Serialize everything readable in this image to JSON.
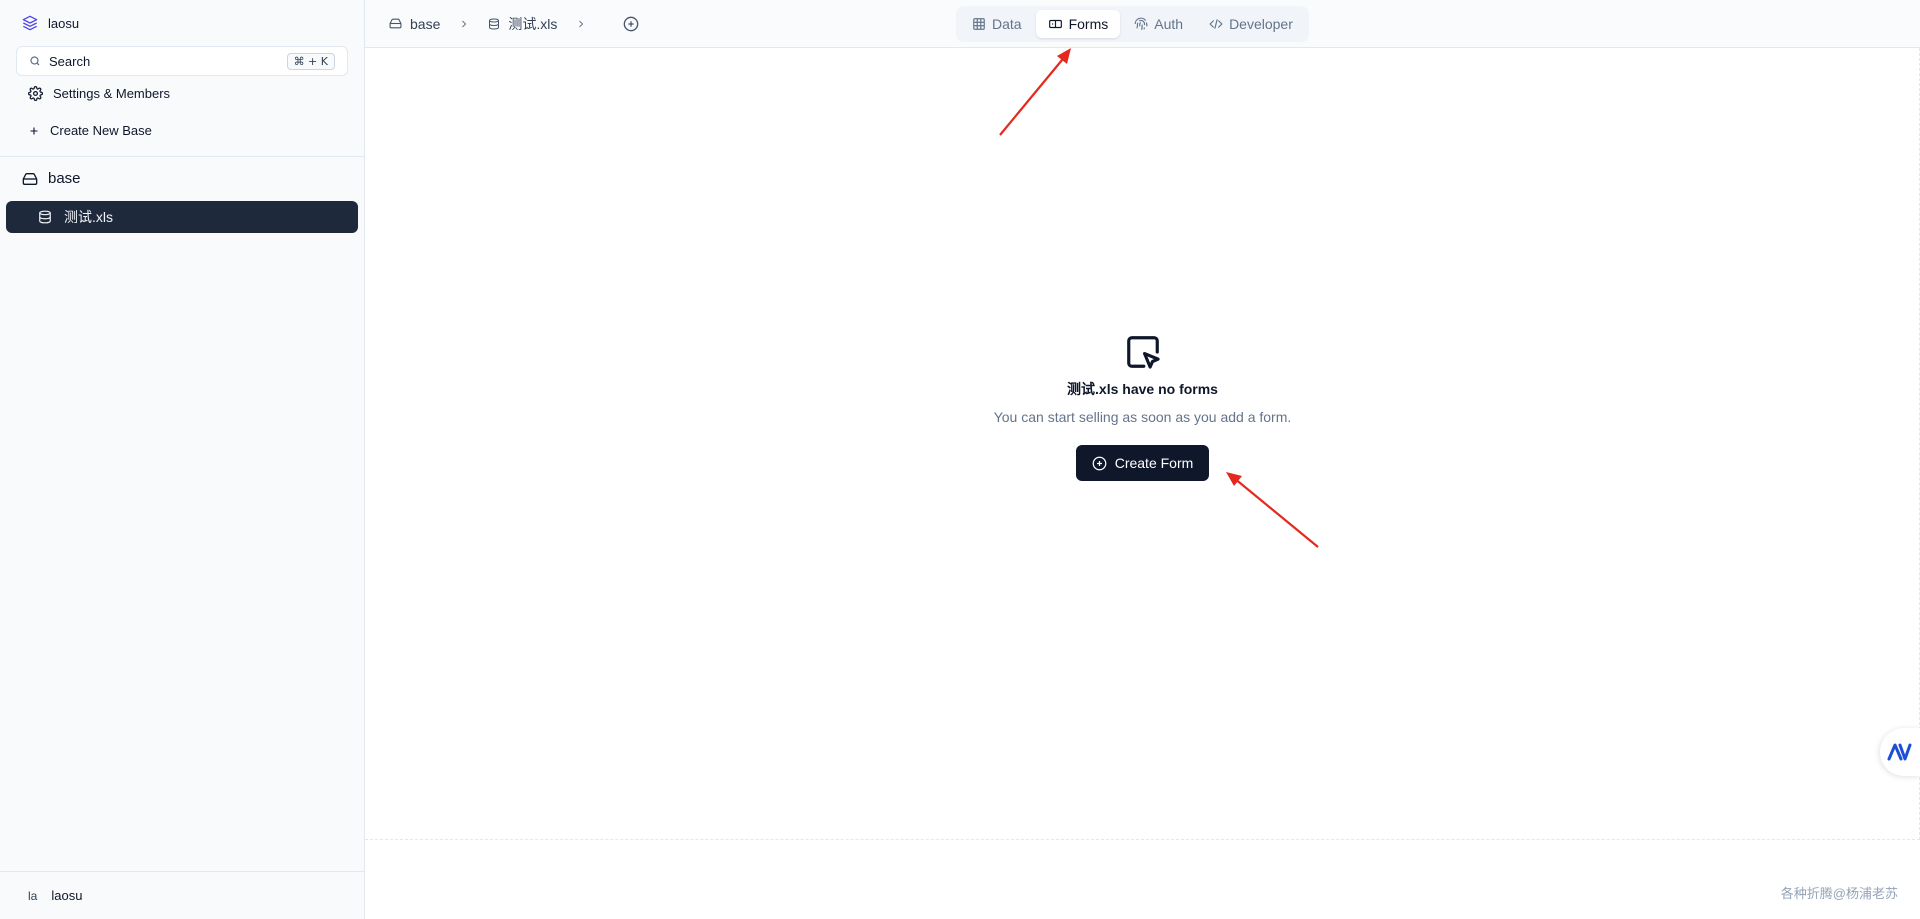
{
  "workspace": {
    "name": "laosu"
  },
  "search": {
    "placeholder": "Search",
    "shortcut": "⌘ + K"
  },
  "sidebar": {
    "settings_label": "Settings & Members",
    "create_base_label": "Create New Base",
    "base_name": "base",
    "table_name": "测试.xls",
    "user_initials": "la",
    "user_name": "laosu"
  },
  "breadcrumb": {
    "base": "base",
    "table": "测试.xls"
  },
  "tabs": [
    {
      "label": "Data",
      "icon": "table-icon",
      "active": false
    },
    {
      "label": "Forms",
      "icon": "forms-icon",
      "active": true
    },
    {
      "label": "Auth",
      "icon": "fingerprint-icon",
      "active": false
    },
    {
      "label": "Developer",
      "icon": "code-icon",
      "active": false
    }
  ],
  "empty_state": {
    "title": "测试.xls have no forms",
    "subtitle": "You can start selling as soon as you add a form.",
    "button_label": "Create Form"
  },
  "watermark": "各种折腾@杨浦老苏",
  "colors": {
    "primary": "#0f172a",
    "selected": "#1e293b",
    "annotation": "#e5281e"
  }
}
